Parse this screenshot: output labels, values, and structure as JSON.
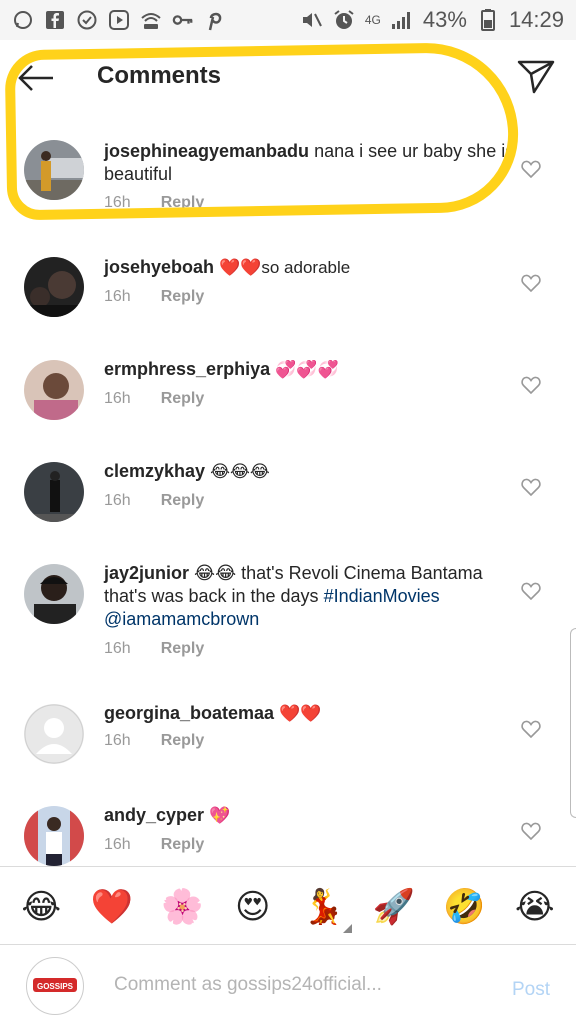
{
  "status_bar": {
    "battery": "43%",
    "time": "14:29",
    "network": "4G",
    "left_icons": [
      "whatsapp-icon",
      "facebook-icon",
      "check-circle-icon",
      "youtube-icon",
      "hotspot-icon",
      "key-icon",
      "pinterest-icon"
    ],
    "right_icons": [
      "mute-icon",
      "alarm-icon",
      "signal-icon",
      "battery-icon"
    ]
  },
  "header": {
    "title": "Comments",
    "back_icon": "arrow-left-icon",
    "share_icon": "paper-plane-icon"
  },
  "comments": [
    {
      "username": "josephineagyemanbadu",
      "text": "nana i see ur baby she is beautiful",
      "time": "16h",
      "reply_label": "Reply"
    },
    {
      "username": "josehyeboah",
      "text": "❤️❤️so adorable",
      "time": "16h",
      "reply_label": "Reply"
    },
    {
      "username": "ermphress_erphiya",
      "text": "💞💞💞",
      "time": "16h",
      "reply_label": "Reply"
    },
    {
      "username": "clemzykhay",
      "text": "😂😂😂",
      "time": "16h",
      "reply_label": "Reply"
    },
    {
      "username": "jay2junior",
      "text_before": "😂😂 that's Revoli Cinema Bantama that's was back in the days ",
      "hashtag": "#IndianMovies",
      "mention": "@iamamamcbrown",
      "time": "16h",
      "reply_label": "Reply"
    },
    {
      "username": "georgina_boatemaa",
      "text": "❤️❤️",
      "time": "16h",
      "reply_label": "Reply"
    },
    {
      "username": "andy_cyper",
      "text": "💖",
      "time": "16h",
      "reply_label": "Reply"
    }
  ],
  "quick_emojis": [
    "😂",
    "❤️",
    "🌸",
    "😍",
    "💃",
    "🚀",
    "🤣",
    "😭"
  ],
  "composer": {
    "placeholder": "Comment as gossips24official...",
    "post_label": "Post",
    "avatar_text": "GOSSIPS"
  },
  "colors": {
    "highlight": "#ffd21a",
    "link": "#003569",
    "muted": "#999999",
    "post_disabled": "#b3d4f5"
  }
}
